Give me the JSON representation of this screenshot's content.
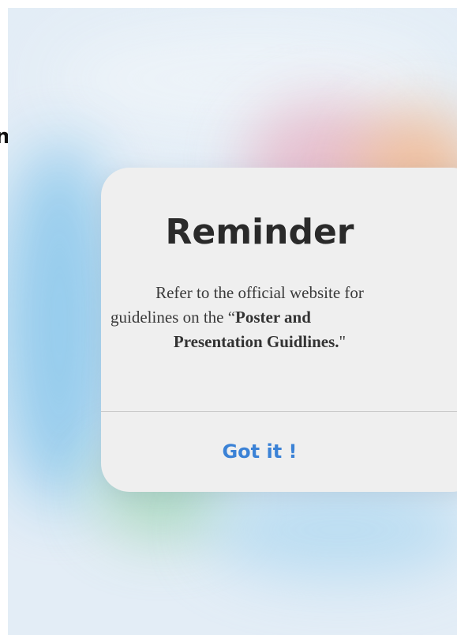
{
  "edge_fragment": "n",
  "dialog": {
    "title": "Reminder",
    "message": {
      "line1": "Refer to the official website for",
      "line2_prefix": "guidelines on the “",
      "line2_bold": "Poster and",
      "line3_bold": "Presentation Guidlines.",
      "line3_suffix": "\""
    },
    "button_label": "Got it !"
  },
  "colors": {
    "dialog_background": "#efefef",
    "title_text": "#2a2a2a",
    "button_text": "#3b82d6",
    "divider": "#c8c8c8"
  }
}
